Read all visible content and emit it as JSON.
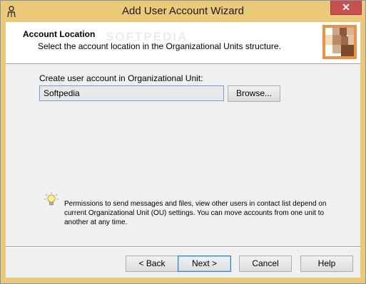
{
  "window": {
    "title": "Add User Account Wizard",
    "close_label": "✕",
    "app_icon": "person-key-icon",
    "titlebar_color": "#eac978",
    "close_color": "#c75050"
  },
  "header": {
    "title": "Account Location",
    "subtitle": "Select the account location in the Organizational Units structure.",
    "watermark": "SOFTPEDIA",
    "icon": "org-unit-blocks-icon"
  },
  "form": {
    "ou_label": "Create user account in Organizational Unit:",
    "ou_value": "Softpedia",
    "browse_label": "Browse..."
  },
  "tip": {
    "icon": "lightbulb-icon",
    "text": "Permissions to send messages and files, view other users in contact list depend on current Organizational Unit (OU) settings. You can move accounts from one unit to another at any time."
  },
  "buttons": {
    "back": "< Back",
    "next": "Next >",
    "cancel": "Cancel",
    "help": "Help"
  }
}
